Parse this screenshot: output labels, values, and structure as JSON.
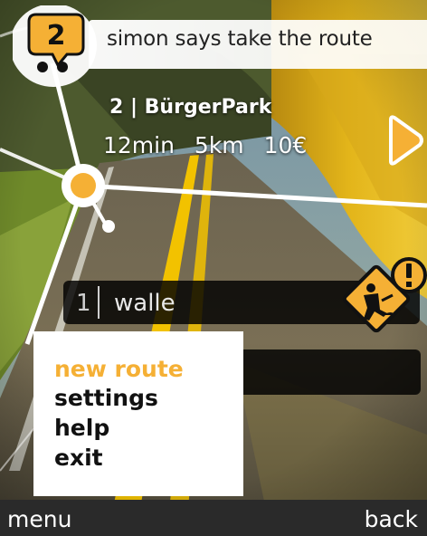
{
  "header": {
    "badge_number": "2",
    "title": "simon says take the route"
  },
  "current_route": {
    "title": "2 | BürgerPark",
    "duration": "12min",
    "distance": "5km",
    "price": "10€"
  },
  "alt_route": {
    "number": "1",
    "name": "walle"
  },
  "menu": {
    "items": [
      {
        "label": "new route",
        "selected": true
      },
      {
        "label": "settings",
        "selected": false
      },
      {
        "label": "help",
        "selected": false
      },
      {
        "label": "exit",
        "selected": false
      }
    ]
  },
  "softkeys": {
    "left": "menu",
    "right": "back"
  },
  "colors": {
    "accent": "#f5b035",
    "road_line": "#f2c200",
    "panel_dark": "#000000"
  },
  "icons": {
    "badge": "speech-bubble-icon",
    "next": "next-arrow-icon",
    "warning": "roadwork-warning-icon",
    "map_node": "route-node-icon"
  }
}
